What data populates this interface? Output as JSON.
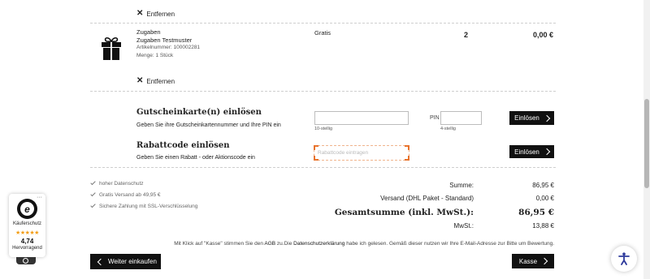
{
  "item1": {
    "remove_label": "Entfernen"
  },
  "item2": {
    "category": "Zugaben",
    "name": "Zugaben Testmuster",
    "article_number": "Artikelnummer: 100002281",
    "quantity_text": "Menge: 1 Stück",
    "price_label": "Gratis",
    "quantity": "2",
    "total": "0,00 €",
    "remove_label": "Entfernen",
    "icon": "gift-icon"
  },
  "voucher": {
    "title": "Gutscheinkarte(n) einlösen",
    "description": "Geben Sie ihre Gutscheinkartennummer und Ihre PIN ein",
    "code_hint": "10-stellig",
    "pin_label": "PIN",
    "pin_hint": "4-stellig",
    "button": "Einlösen"
  },
  "discount": {
    "title": "Rabattcode einlösen",
    "description": "Geben Sie einen Rabatt - oder Aktionscode ein",
    "placeholder": "Rabattcode eintragen",
    "button": "Einlösen"
  },
  "trust_points": [
    "hoher Datenschutz",
    "Gratis Versand ab 49,95 €",
    "Sichere Zahlung mit SSL-Verschlüsselung"
  ],
  "summary": {
    "subtotal_label": "Summe:",
    "subtotal_value": "86,95 €",
    "shipping_label": "Versand (DHL Paket - Standard)",
    "shipping_value": "0,00 €",
    "total_label": "Gesamtsumme (inkl. MwSt.):",
    "total_value": "86,95 €",
    "vat_label": "MwSt.:",
    "vat_value": "13,88 €"
  },
  "legal": {
    "part1": "Mit Klick auf \"Kasse\" stimmen Sie den ",
    "agb": "AGB",
    "part2": " zu.Die ",
    "privacy": "Datenschutzerklärung",
    "part3": " habe ich gelesen. Gemäß dieser nutzen wir Ihre E-Mail-Adresse zur Bitte um Bewertung."
  },
  "nav": {
    "continue_shopping": "Weiter einkaufen",
    "checkout": "Kasse"
  },
  "trusted_badge": {
    "letter": "e",
    "name": "Käuferschutz",
    "stars": "★★★★★",
    "rating": "4,74",
    "rating_text": "Hervorragend",
    "more": "···"
  },
  "colors": {
    "accent_orange": "#e8732c",
    "dark": "#111111",
    "star_orange": "#f39c12"
  }
}
